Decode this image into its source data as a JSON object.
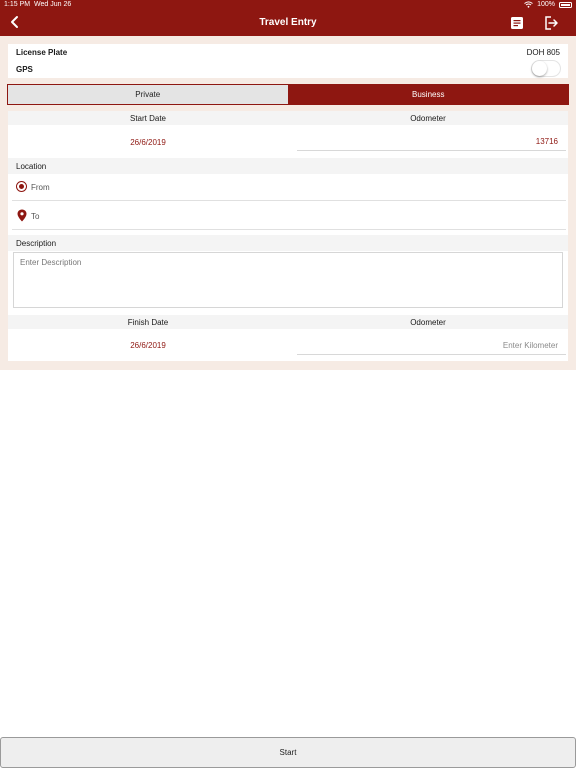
{
  "status_bar": {
    "time": "1:15 PM",
    "date": "Wed Jun 26",
    "battery": "100%"
  },
  "nav": {
    "title": "Travel Entry",
    "back_icon": "chevron-left-icon",
    "note_icon": "note-icon",
    "exit_icon": "exit-icon"
  },
  "vehicle": {
    "plate_label": "License Plate",
    "plate_value": "DOH 805",
    "gps_label": "GPS",
    "gps_on": false
  },
  "segment": {
    "private_label": "Private",
    "business_label": "Business",
    "selected": "Business"
  },
  "start": {
    "date_header": "Start Date",
    "odometer_header": "Odometer",
    "date_value": "26/6/2019",
    "odometer_value": "13716"
  },
  "location": {
    "label": "Location",
    "from_placeholder": "From",
    "to_placeholder": "To"
  },
  "description": {
    "label": "Description",
    "placeholder": "Enter Description"
  },
  "finish": {
    "date_header": "Finish Date",
    "odometer_header": "Odometer",
    "date_value": "26/6/2019",
    "odometer_placeholder": "Enter Kilometer"
  },
  "actions": {
    "start_label": "Start"
  },
  "colors": {
    "accent": "#8e1711",
    "background": "#f6ebe4"
  }
}
